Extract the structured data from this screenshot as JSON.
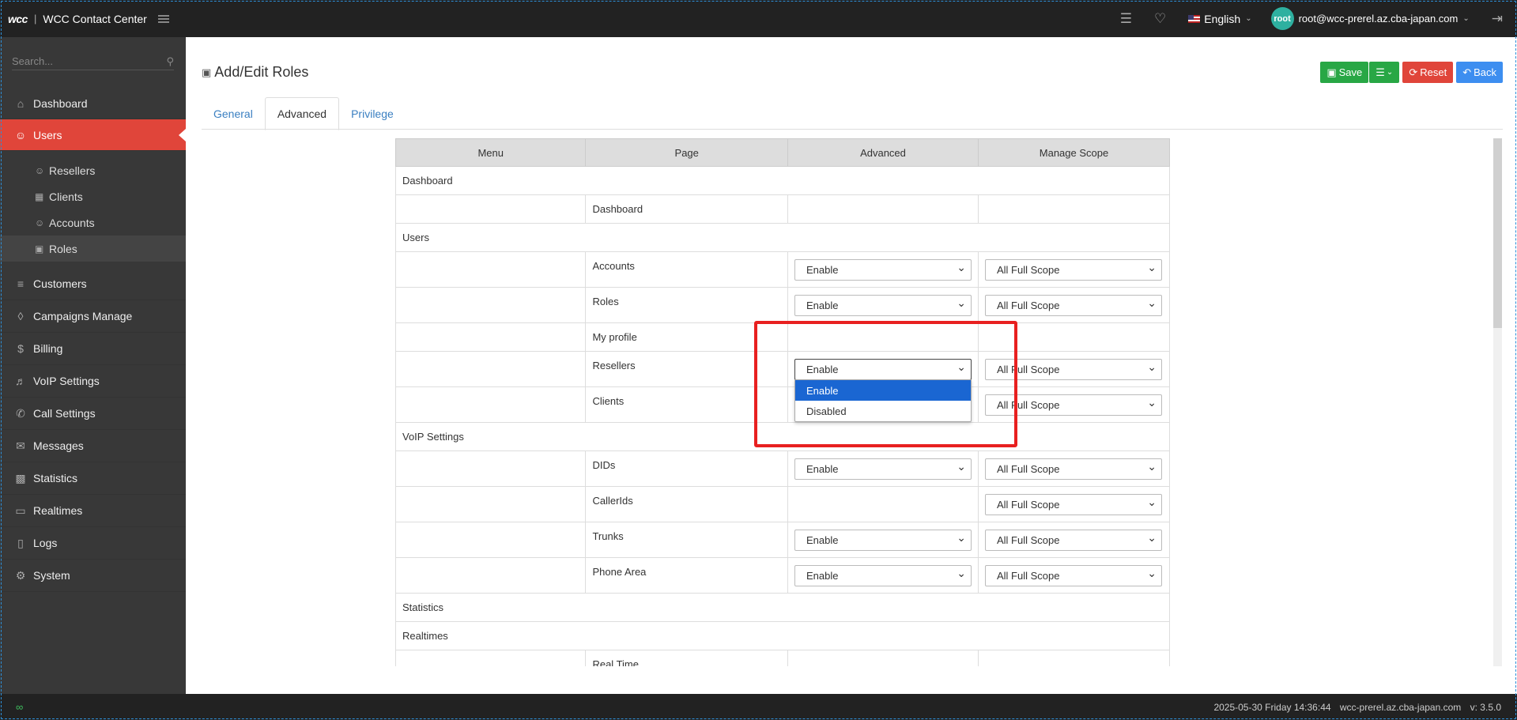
{
  "topbar": {
    "logo": "wcc",
    "title": "WCC Contact Center",
    "language": "English",
    "avatar_text": "root",
    "user_email": "root@wcc-prerel.az.cba-japan.com"
  },
  "sidebar": {
    "search_placeholder": "Search...",
    "items": [
      {
        "label": "Dashboard",
        "icon": "home-icon"
      },
      {
        "label": "Users",
        "icon": "user-icon"
      },
      {
        "label": "Customers",
        "icon": "database-icon"
      },
      {
        "label": "Campaigns Manage",
        "icon": "layers-icon"
      },
      {
        "label": "Billing",
        "icon": "dollar-icon"
      },
      {
        "label": "VoIP Settings",
        "icon": "speaker-icon"
      },
      {
        "label": "Call Settings",
        "icon": "phone-icon"
      },
      {
        "label": "Messages",
        "icon": "envelope-icon"
      },
      {
        "label": "Statistics",
        "icon": "bar-chart-icon"
      },
      {
        "label": "Realtimes",
        "icon": "monitor-icon"
      },
      {
        "label": "Logs",
        "icon": "book-icon"
      },
      {
        "label": "System",
        "icon": "gear-icon"
      }
    ],
    "users_sub": [
      {
        "label": "Resellers",
        "icon": "user-icon"
      },
      {
        "label": "Clients",
        "icon": "windows-icon"
      },
      {
        "label": "Accounts",
        "icon": "user-icon"
      },
      {
        "label": "Roles",
        "icon": "roles-icon"
      }
    ]
  },
  "page": {
    "title": "Add/Edit Roles",
    "save_label": "Save",
    "reset_label": "Reset",
    "back_label": "Back",
    "tabs": [
      "General",
      "Advanced",
      "Privilege"
    ]
  },
  "table": {
    "headers": [
      "Menu",
      "Page",
      "Advanced",
      "Manage Scope"
    ],
    "sections": {
      "dashboard": "Dashboard",
      "users": "Users",
      "voip": "VoIP Settings",
      "statistics": "Statistics",
      "realtimes": "Realtimes"
    },
    "pages": {
      "dashboard": "Dashboard",
      "accounts": "Accounts",
      "roles": "Roles",
      "my_profile": "My profile",
      "resellers": "Resellers",
      "clients": "Clients",
      "dids": "DIDs",
      "callerids": "CallerIds",
      "trunks": "Trunks",
      "phone_area": "Phone Area",
      "real_time": "Real Time"
    },
    "enable": "Enable",
    "full_scope": "All Full Scope"
  },
  "dropdown": {
    "options": [
      "Enable",
      "Disabled"
    ],
    "selected": "Enable"
  },
  "status": {
    "datetime": "2025-05-30 Friday 14:36:44",
    "host": "wcc-prerel.az.cba-japan.com",
    "version": "v: 3.5.0"
  },
  "colors": {
    "accent_red": "#e0453a",
    "save_green": "#28a745",
    "back_blue": "#3d8ef0",
    "highlight_red": "#e82020"
  }
}
